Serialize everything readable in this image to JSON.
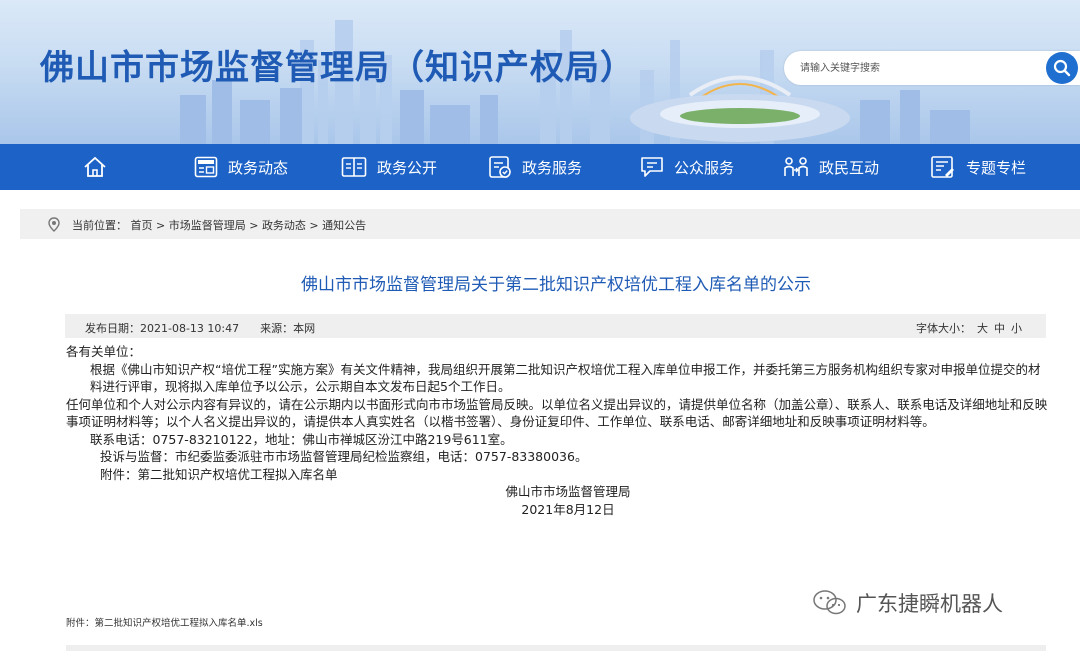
{
  "header": {
    "title": "佛山市市场监督管理局（知识产权局）",
    "search_placeholder": "请输入关键字搜索"
  },
  "nav": {
    "items": [
      {
        "label": "政务动态",
        "icon": "news-icon"
      },
      {
        "label": "政务公开",
        "icon": "book-icon"
      },
      {
        "label": "政务服务",
        "icon": "service-icon"
      },
      {
        "label": "公众服务",
        "icon": "chat-icon"
      },
      {
        "label": "政民互动",
        "icon": "people-icon"
      },
      {
        "label": "专题专栏",
        "icon": "topic-icon"
      }
    ]
  },
  "breadcrumb": {
    "prefix": "当前位置：",
    "items": [
      "首页",
      "市场监督管理局",
      "政务动态",
      "通知公告"
    ],
    "sep": " > "
  },
  "article": {
    "title": "佛山市市场监督管理局关于第二批知识产权培优工程入库名单的公示",
    "publish": "发布日期：2021-08-13 10:47",
    "source": "来源：本网",
    "font_size_label": "字体大小：",
    "sizes": [
      "大",
      "中",
      "小"
    ],
    "salutation": "各有关单位：",
    "p1": "根据《佛山市知识产权“培优工程”实施方案》有关文件精神，我局组织开展第二批知识产权培优工程入库单位申报工作，并委托第三方服务机构组织专家对申报单位提交的材料进行评审，现将拟入库单位予以公示，公示期自本文发布日起5个工作日。",
    "p2": "任何单位和个人对公示内容有异议的，请在公示期内以书面形式向市市场监管局反映。以单位名义提出异议的，请提供单位名称（加盖公章）、联系人、联系电话及详细地址和反映事项证明材料等；以个人名义提出异议的，请提供本人真实姓名（以楷书签署）、身份证复印件、工作单位、联系电话、邮寄详细地址和反映事项证明材料等。",
    "contact": "联系电话：0757-83210122，地址：佛山市禅城区汾江中路219号611室。",
    "complaint": "投诉与监督：市纪委监委派驻市市场监督管理局纪检监察组，电话：0757-83380036。",
    "attachment_line": "附件：第二批知识产权培优工程拟入库名单",
    "signature": "佛山市市场监督管理局",
    "date": "2021年8月12日",
    "attach_file": "附件：第二批知识产权培优工程拟入库名单.xls"
  },
  "watermark": "广东捷瞬机器人"
}
